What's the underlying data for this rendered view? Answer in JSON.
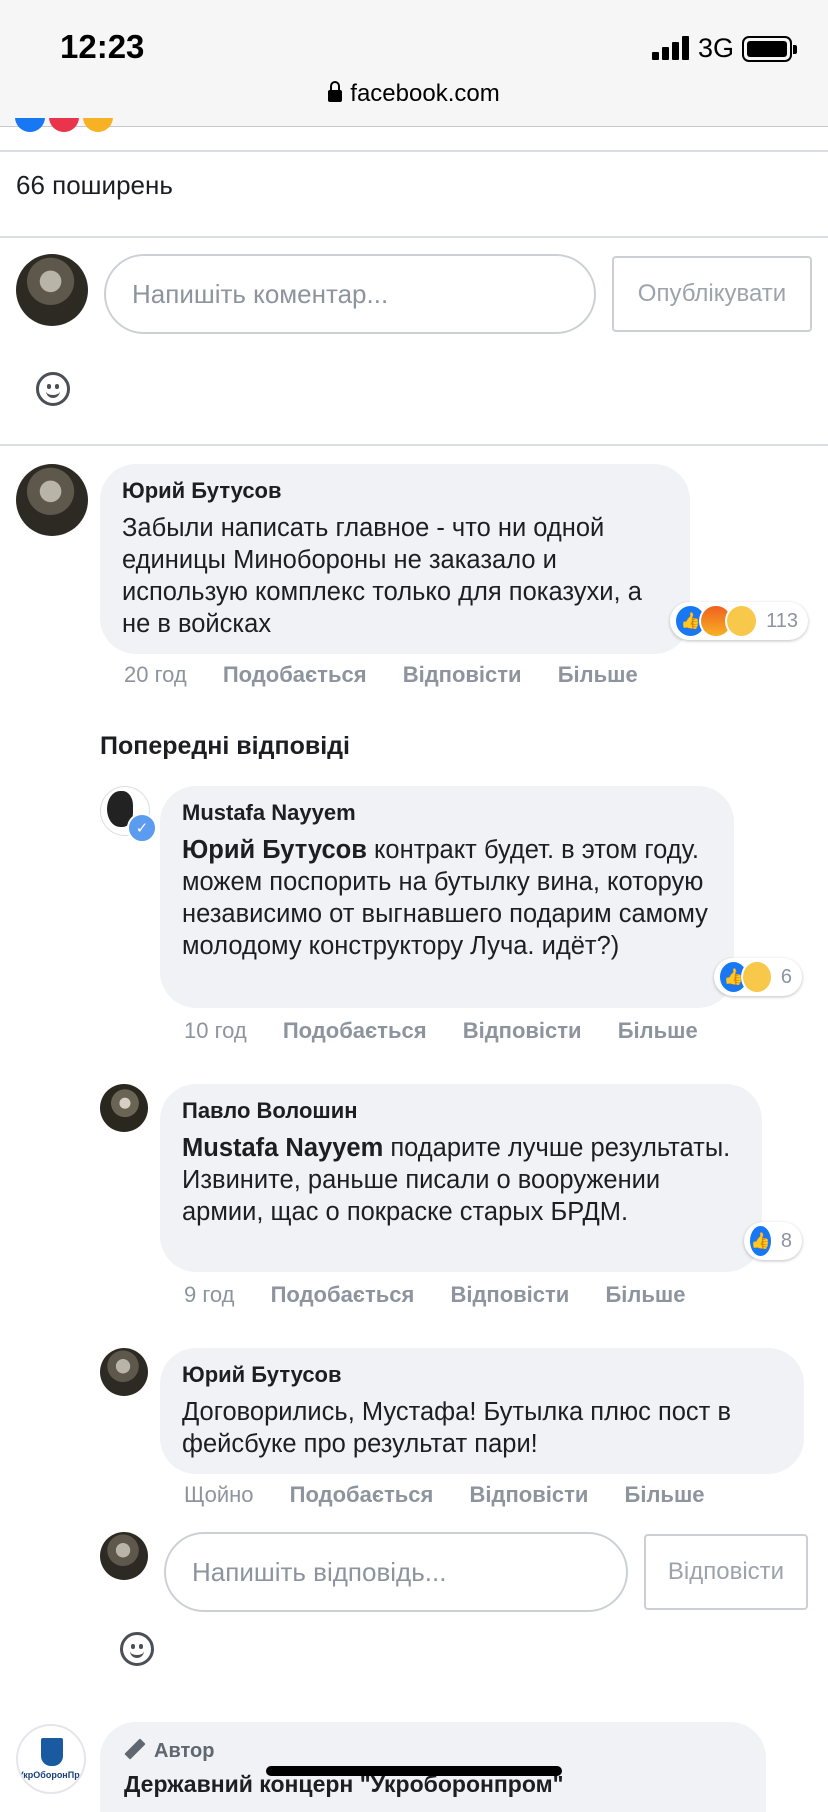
{
  "status_bar": {
    "time": "12:23",
    "network": "3G",
    "url": "facebook.com"
  },
  "post": {
    "shares": "66 поширень"
  },
  "comment_box": {
    "placeholder": "Напишіть коментар...",
    "publish_label": "Опублікувати"
  },
  "comments": [
    {
      "author": "Юрий Бутусов",
      "text": "Забыли написать главное - что ни одной единицы Минобороны не заказало и использую комплекс только для показухи, а не в войсках",
      "reactions_count": "113",
      "time": "20 год",
      "like": "Подобається",
      "reply": "Відповісти",
      "more": "Більше"
    }
  ],
  "previous_replies_label": "Попередні відповіді",
  "replies": [
    {
      "author": "Mustafa Nayyem",
      "mention": "Юрий Бутусов",
      "text": " контракт будет. в этом году. можем поспорить на бутылку вина, которую независимо от выгнавшего подарим самому молодому конструктору Луча. идёт?)",
      "reactions_count": "6",
      "time": "10 год",
      "like": "Подобається",
      "reply": "Відповісти",
      "more": "Більше"
    },
    {
      "author": "Павло Волошин",
      "mention": "Mustafa Nayyem",
      "text": " подарите лучше результаты. Извините, раньше писали о вооружении армии, щас о покраске старых БРДМ.",
      "reactions_count": "8",
      "time": "9 год",
      "like": "Подобається",
      "reply": "Відповісти",
      "more": "Більше"
    },
    {
      "author": "Юрий Бутусов",
      "text": "Договорились, Мустафа! Бутылка плюс пост в фейсбуке про результат пари!",
      "time": "Щойно",
      "like": "Подобається",
      "reply": "Відповісти",
      "more": "Більше"
    }
  ],
  "reply_box": {
    "placeholder": "Напишіть відповідь...",
    "reply_label": "Відповісти"
  },
  "next_comment": {
    "badge": "Автор",
    "author": "Державний концерн \"Укроборонпром\"",
    "logo_text": "УкрОборонПром"
  },
  "colors": {
    "like_blue": "#1877f2",
    "bubble_bg": "#f0f2f5",
    "secondary_text": "#8d949e"
  }
}
